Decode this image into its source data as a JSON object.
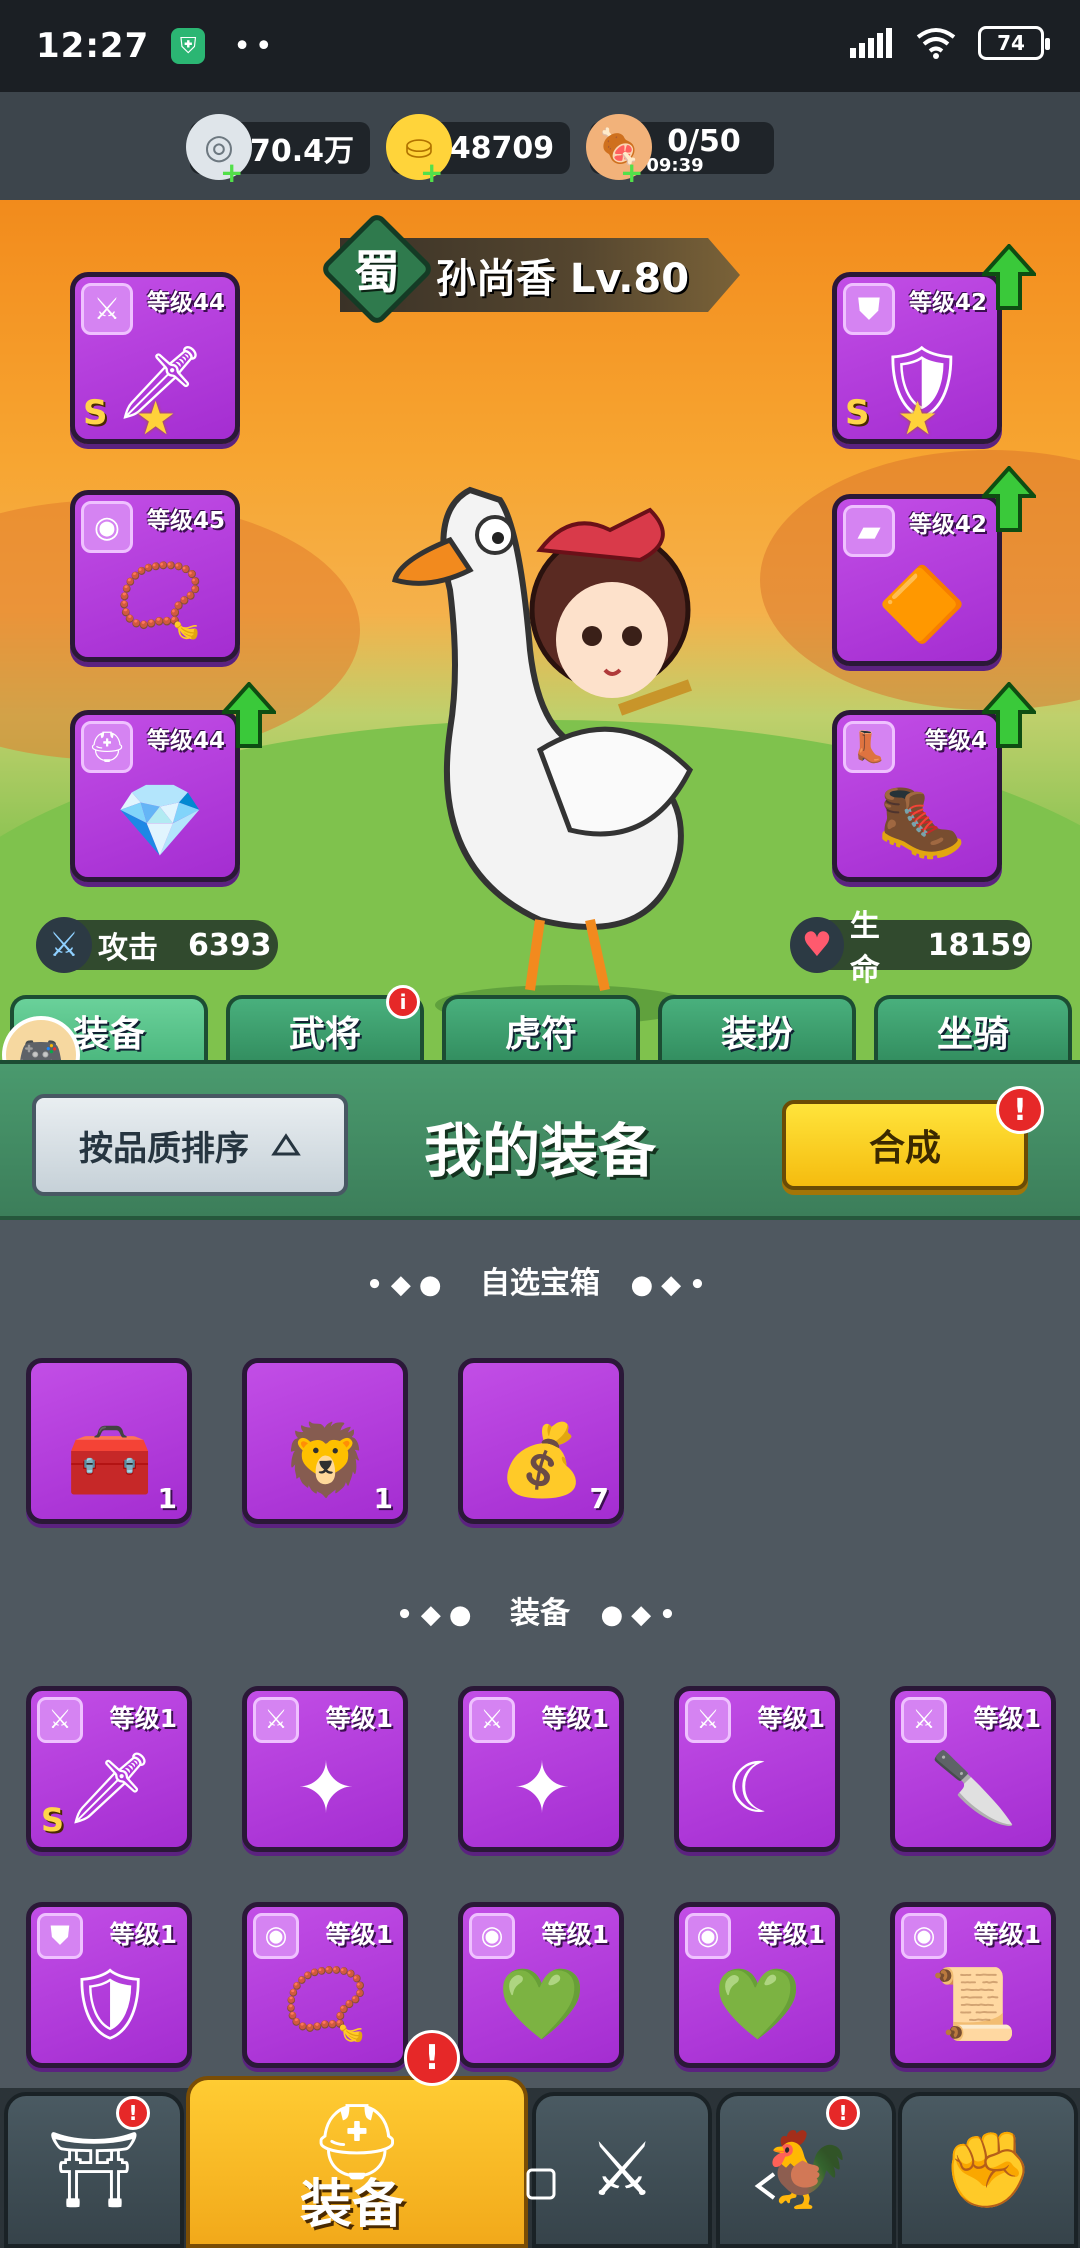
{
  "status_bar": {
    "time": "12:27",
    "dots": "••",
    "battery": "74"
  },
  "resources": [
    {
      "name": "silver-coin",
      "value": "70.4万",
      "sub": ""
    },
    {
      "name": "gold-ingot",
      "value": "48709",
      "sub": ""
    },
    {
      "name": "meat-stamina",
      "value": "0/50",
      "sub": "09:39"
    }
  ],
  "hero": {
    "faction": "蜀",
    "name": "孙尚香 Lv.80"
  },
  "equip_slots": [
    {
      "id": "weapon",
      "level": "等级44",
      "grade": "S",
      "starred": true,
      "upgrade": false,
      "icon": "sword"
    },
    {
      "id": "armor",
      "level": "等级42",
      "grade": "S",
      "starred": true,
      "upgrade": true,
      "icon": "armor"
    },
    {
      "id": "necklace",
      "level": "等级45",
      "grade": "",
      "starred": false,
      "upgrade": false,
      "icon": "medal"
    },
    {
      "id": "bracer",
      "level": "等级42",
      "grade": "",
      "starred": false,
      "upgrade": true,
      "icon": "bracer"
    },
    {
      "id": "helmet",
      "level": "等级44",
      "grade": "",
      "starred": false,
      "upgrade": true,
      "icon": "helmet"
    },
    {
      "id": "boots",
      "level": "等级4",
      "grade": "",
      "starred": false,
      "upgrade": true,
      "icon": "boot"
    }
  ],
  "stats": {
    "attack_label": "攻击",
    "attack_value": "6393",
    "hp_label": "生命",
    "hp_value": "18159"
  },
  "tabs": [
    "装备",
    "武将",
    "虎符",
    "装扮",
    "坐骑"
  ],
  "panel": {
    "sort_label": "按品质排序",
    "title": "我的装备",
    "merge_label": "合成"
  },
  "sections": {
    "chests_title": "自选宝箱",
    "equip_title": "装备"
  },
  "chests": [
    {
      "count": "1",
      "icon": "chest-shield"
    },
    {
      "count": "1",
      "icon": "chest-lion"
    },
    {
      "count": "7",
      "icon": "treasure-pile"
    }
  ],
  "equipment_items": [
    {
      "level": "等级1",
      "grade": "S",
      "icon": "sword"
    },
    {
      "level": "等级1",
      "grade": "",
      "icon": "sword"
    },
    {
      "level": "等级1",
      "grade": "",
      "icon": "sword"
    },
    {
      "level": "等级1",
      "grade": "",
      "icon": "sword"
    },
    {
      "level": "等级1",
      "grade": "",
      "icon": "sword"
    },
    {
      "level": "等级1",
      "grade": "",
      "icon": "armor"
    },
    {
      "level": "等级1",
      "grade": "",
      "icon": "medal"
    },
    {
      "level": "等级1",
      "grade": "",
      "icon": "medal"
    },
    {
      "level": "等级1",
      "grade": "",
      "icon": "medal"
    },
    {
      "level": "等级1",
      "grade": "",
      "icon": "medal"
    }
  ],
  "bottom_nav": {
    "active_label": "装备"
  },
  "colors": {
    "rare_purple": "#b23ddc",
    "accent_green": "#4bb77e",
    "accent_yellow": "#f5bc0f",
    "alert_red": "#e62828"
  }
}
